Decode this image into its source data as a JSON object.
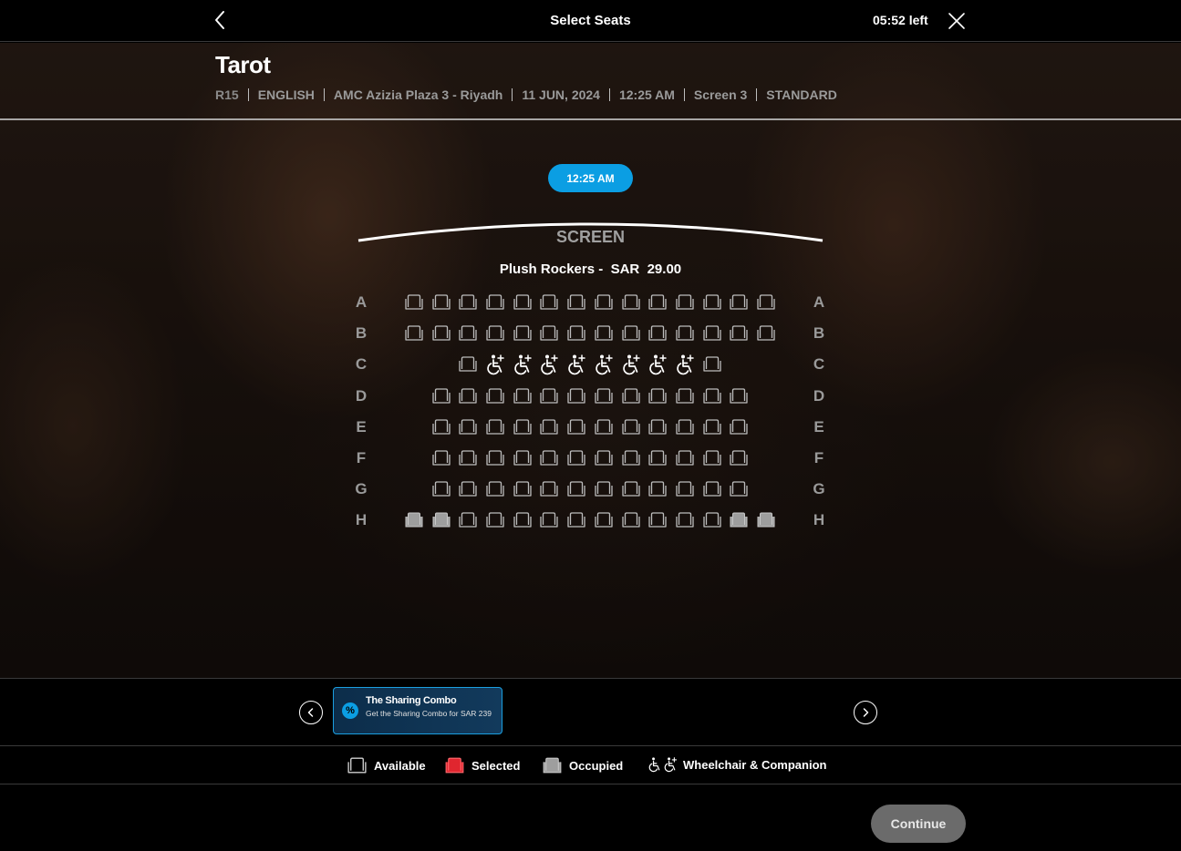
{
  "header": {
    "title": "Select Seats",
    "timer": "05:52 left",
    "back_icon": "chevron-left-icon",
    "close_icon": "close-icon"
  },
  "movie": {
    "title": "Tarot",
    "meta": [
      "R15",
      "ENGLISH",
      "AMC Azizia Plaza 3 - Riyadh",
      "11 JUN, 2024",
      "12:25 AM",
      "Screen 3",
      "STANDARD"
    ]
  },
  "showtime": "12:25 AM",
  "screen_label": "SCREEN",
  "seat_class": {
    "name": "Plush Rockers -",
    "currency": "SAR",
    "price": "29.00"
  },
  "seat_map": {
    "rows": [
      {
        "label": "A",
        "seats": [
          "available",
          "available",
          "available",
          "available",
          "available",
          "available",
          "available",
          "available",
          "available",
          "available",
          "available",
          "available",
          "available",
          "available"
        ]
      },
      {
        "label": "B",
        "seats": [
          "available",
          "available",
          "available",
          "available",
          "available",
          "available",
          "available",
          "available",
          "available",
          "available",
          "available",
          "available",
          "available",
          "available"
        ]
      },
      {
        "label": "C",
        "seats": [
          "available",
          "wheelchair",
          "wheelchair",
          "wheelchair",
          "wheelchair",
          "wheelchair",
          "wheelchair",
          "wheelchair",
          "wheelchair",
          "available"
        ]
      },
      {
        "label": "D",
        "seats": [
          "available",
          "available",
          "available",
          "available",
          "available",
          "available",
          "available",
          "available",
          "available",
          "available",
          "available",
          "available"
        ]
      },
      {
        "label": "E",
        "seats": [
          "available",
          "available",
          "available",
          "available",
          "available",
          "available",
          "available",
          "available",
          "available",
          "available",
          "available",
          "available"
        ]
      },
      {
        "label": "F",
        "seats": [
          "available",
          "available",
          "available",
          "available",
          "available",
          "available",
          "available",
          "available",
          "available",
          "available",
          "available",
          "available"
        ]
      },
      {
        "label": "G",
        "seats": [
          "available",
          "available",
          "available",
          "available",
          "available",
          "available",
          "available",
          "available",
          "available",
          "available",
          "available",
          "available"
        ]
      },
      {
        "label": "H",
        "seats": [
          "occupied",
          "occupied",
          "available",
          "available",
          "available",
          "available",
          "available",
          "available",
          "available",
          "available",
          "available",
          "available",
          "occupied",
          "occupied"
        ]
      }
    ]
  },
  "offer": {
    "title": "The Sharing Combo",
    "description": "Get the Sharing Combo for SAR 239",
    "icon": "percent-badge-icon"
  },
  "legend": {
    "available": "Available",
    "selected": "Selected",
    "occupied": "Occupied",
    "wheelchair": "Wheelchair & Companion"
  },
  "colors": {
    "accent": "#0b9ee3",
    "selected": "#e0262f",
    "occupied": "#9e9e9e",
    "seat_outline": "#bdbdbd"
  },
  "footer": {
    "continue_label": "Continue"
  }
}
